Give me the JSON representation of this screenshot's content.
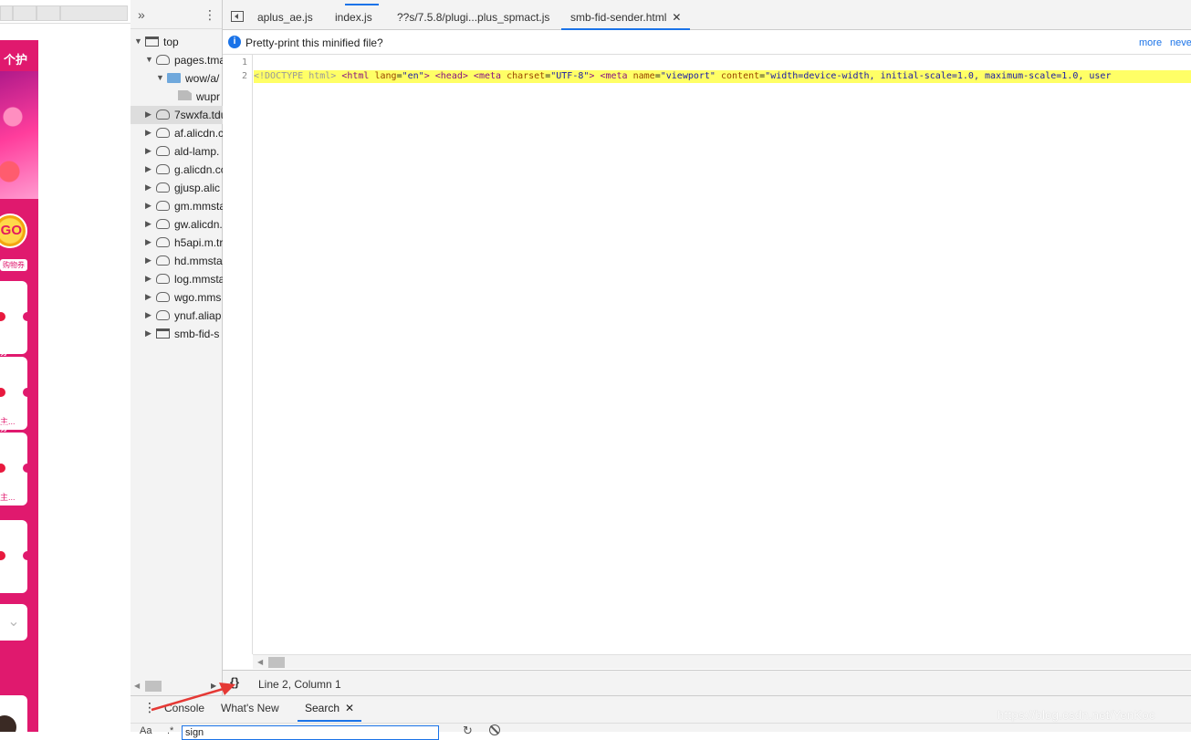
{
  "page_preview": {
    "header_text": "个护",
    "go_badge": "GO",
    "tag_text": "购物券",
    "cards": [
      {
        "title": "",
        "label": ""
      },
      {
        "title": "券",
        "label": "主..."
      },
      {
        "title": "券",
        "label": "主..."
      },
      {
        "title": "",
        "label": ""
      }
    ]
  },
  "navigator": {
    "more_icon": "»",
    "menu_icon": "⋮",
    "tree": [
      {
        "label": "top",
        "indent": 0,
        "twisty": "open",
        "icon": "frame",
        "selected": false
      },
      {
        "label": "pages.tma",
        "indent": 1,
        "twisty": "open",
        "icon": "cloud",
        "selected": false
      },
      {
        "label": "wow/a/",
        "indent": 2,
        "twisty": "open",
        "icon": "folder",
        "selected": false
      },
      {
        "label": "wupr",
        "indent": 3,
        "twisty": "none",
        "icon": "file",
        "selected": false
      },
      {
        "label": "7swxfa.tdu",
        "indent": 1,
        "twisty": "closed",
        "icon": "cloud",
        "selected": true
      },
      {
        "label": "af.alicdn.c",
        "indent": 1,
        "twisty": "closed",
        "icon": "cloud",
        "selected": false
      },
      {
        "label": "ald-lamp.",
        "indent": 1,
        "twisty": "closed",
        "icon": "cloud",
        "selected": false
      },
      {
        "label": "g.alicdn.cc",
        "indent": 1,
        "twisty": "closed",
        "icon": "cloud",
        "selected": false
      },
      {
        "label": "gjusp.alic",
        "indent": 1,
        "twisty": "closed",
        "icon": "cloud",
        "selected": false
      },
      {
        "label": "gm.mmsta",
        "indent": 1,
        "twisty": "closed",
        "icon": "cloud",
        "selected": false
      },
      {
        "label": "gw.alicdn.",
        "indent": 1,
        "twisty": "closed",
        "icon": "cloud",
        "selected": false
      },
      {
        "label": "h5api.m.tr",
        "indent": 1,
        "twisty": "closed",
        "icon": "cloud",
        "selected": false
      },
      {
        "label": "hd.mmsta",
        "indent": 1,
        "twisty": "closed",
        "icon": "cloud",
        "selected": false
      },
      {
        "label": "log.mmsta",
        "indent": 1,
        "twisty": "closed",
        "icon": "cloud",
        "selected": false
      },
      {
        "label": "wgo.mms",
        "indent": 1,
        "twisty": "closed",
        "icon": "cloud",
        "selected": false
      },
      {
        "label": "ynuf.aliap",
        "indent": 1,
        "twisty": "closed",
        "icon": "cloud",
        "selected": false
      },
      {
        "label": "smb-fid-s",
        "indent": 1,
        "twisty": "closed",
        "icon": "frame",
        "selected": false
      }
    ]
  },
  "editor": {
    "tabs": [
      {
        "label": "aplus_ae.js",
        "active": false,
        "closable": false
      },
      {
        "label": "index.js",
        "active": false,
        "closable": false
      },
      {
        "label": "??s/7.5.8/plugi...plus_spmact.js",
        "active": false,
        "closable": false
      },
      {
        "label": "smb-fid-sender.html",
        "active": true,
        "closable": true
      }
    ],
    "close_glyph": "✕",
    "infobar": {
      "message": "Pretty-print this minified file?",
      "more_link": "more",
      "never_link": "neve"
    },
    "line_numbers": [
      "1",
      "2"
    ],
    "code_line2": {
      "doctype": "<!DOCTYPE html>",
      "html_open": "<html",
      "lang_attr": "lang",
      "lang_val": "\"en\"",
      "head": "<head>",
      "meta1_open": "<meta",
      "charset_attr": "charset",
      "charset_val": "\"UTF-8\"",
      "meta2_open": "<meta",
      "name_attr": "name",
      "name_val": "\"viewport\"",
      "content_attr": "content",
      "content_val": "\"width=device-width, initial-scale=1.0, maximum-scale=1.0, user"
    },
    "status": {
      "pretty_print_glyph": "{}",
      "cursor_position": "Line 2, Column 1"
    }
  },
  "drawer": {
    "tabs": [
      {
        "label": "Console",
        "active": false
      },
      {
        "label": "What's New",
        "active": false
      },
      {
        "label": "Search",
        "active": true
      }
    ],
    "case_toggle": "Aa",
    "regex_toggle": ".*",
    "search_value": "sign"
  },
  "watermark": "https://blog.csdn.net/YenKoc",
  "colors": {
    "accent": "#1a73e8",
    "highlight": "#ffff66",
    "page_pink": "#e0196e",
    "annotation_arrow": "#e53935"
  }
}
